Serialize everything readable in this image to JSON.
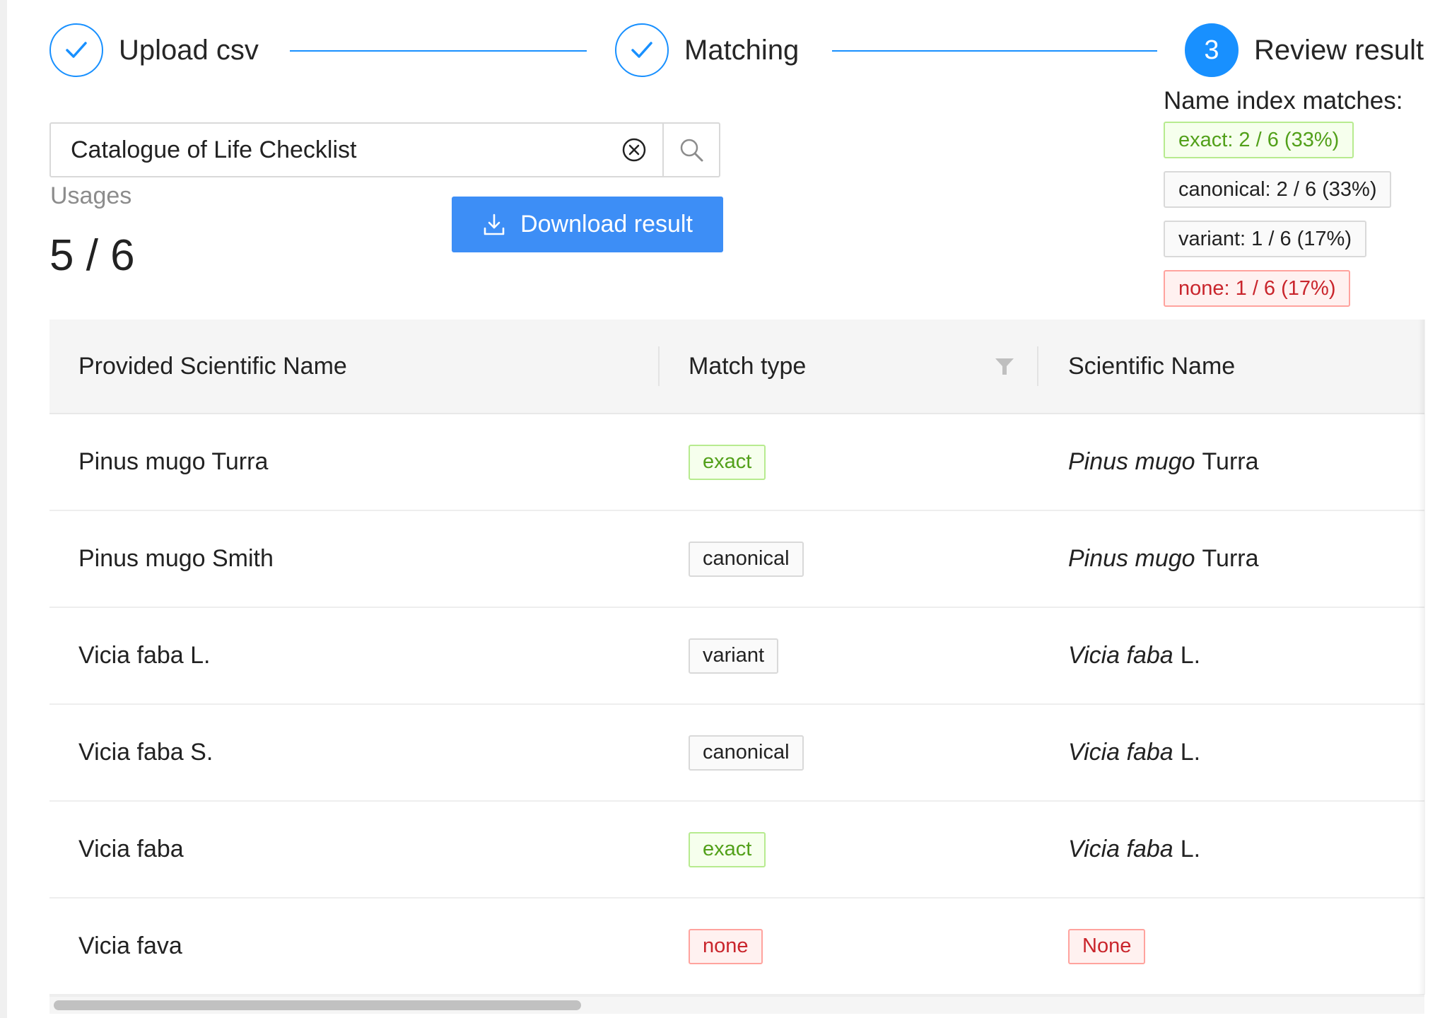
{
  "steps": [
    {
      "title": "Upload csv",
      "status": "finished",
      "icon": "check-icon"
    },
    {
      "title": "Matching",
      "status": "finished",
      "icon": "check-icon"
    },
    {
      "title": "Review result",
      "status": "active",
      "number": "3"
    }
  ],
  "search": {
    "value": "Catalogue of Life Checklist"
  },
  "usages": {
    "label": "Usages",
    "value": "5 / 6"
  },
  "download": {
    "label": "Download result",
    "icon": "download-icon"
  },
  "name_index": {
    "title": "Name index matches:",
    "tags": [
      {
        "type": "exact",
        "label": "exact: 2 / 6 (33%)"
      },
      {
        "type": "canonical",
        "label": "canonical: 2 / 6 (33%)"
      },
      {
        "type": "variant",
        "label": "variant: 1 / 6 (17%)"
      },
      {
        "type": "none",
        "label": "none: 1 / 6 (17%)"
      }
    ]
  },
  "table": {
    "columns": [
      "Provided Scientific Name",
      "Match type",
      "Scientific Name"
    ],
    "rows": [
      {
        "provided": "Pinus mugo Turra",
        "match_type": "exact",
        "sci_name": "Pinus mugo",
        "sci_author": "Turra"
      },
      {
        "provided": "Pinus mugo Smith",
        "match_type": "canonical",
        "sci_name": "Pinus mugo",
        "sci_author": "Turra"
      },
      {
        "provided": "Vicia faba L.",
        "match_type": "variant",
        "sci_name": "Vicia faba",
        "sci_author": "L."
      },
      {
        "provided": "Vicia faba S.",
        "match_type": "canonical",
        "sci_name": "Vicia faba",
        "sci_author": "L."
      },
      {
        "provided": "Vicia faba",
        "match_type": "exact",
        "sci_name": "Vicia faba",
        "sci_author": "L."
      },
      {
        "provided": "Vicia fava",
        "match_type": "none",
        "sci_name_tag": "None"
      }
    ]
  },
  "colors": {
    "primary": "#1890ff",
    "button": "#3d8ef6",
    "exact_text": "#52a01a",
    "exact_bg": "#f6ffed",
    "none_text": "#c9252c",
    "none_bg": "#fff1f0"
  }
}
